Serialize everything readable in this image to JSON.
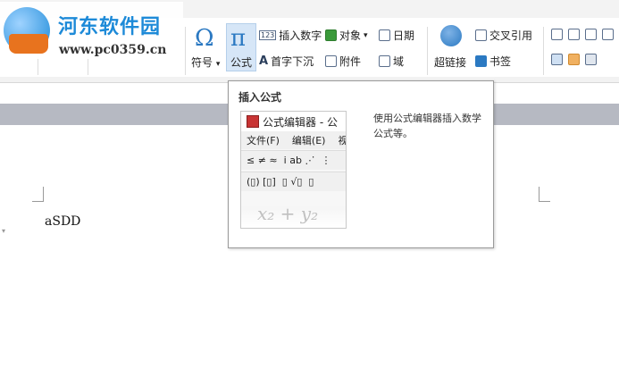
{
  "watermark": {
    "title": "河东软件园",
    "url": "www.pc0359.cn"
  },
  "ribbon": {
    "symbol_label": "符号",
    "formula_label": "公式",
    "insert_number_label": "插入数字",
    "first_letter_label": "首字下沉",
    "object_label": "对象",
    "attachment_label": "附件",
    "date_label": "日期",
    "field_label": "域",
    "hyperlink_label": "超链接",
    "cross_ref_label": "交叉引用",
    "bookmark_label": "书签",
    "dropdown_arrow": "▾",
    "number_icon_text": "123"
  },
  "tooltip": {
    "title": "插入公式",
    "description": "使用公式编辑器插入数学公式等。",
    "preview": {
      "window_title": "公式编辑器 - 公",
      "menu_file": "文件(F)",
      "menu_edit": "编辑(E)",
      "menu_more": "视",
      "row1": [
        "≤ ≠ ≈",
        "ⅰ ab ⋰",
        "⋮"
      ],
      "row2": [
        "(▯) [▯]",
        "▯ √▯",
        "▯"
      ],
      "formula": "x₂ + y₂"
    }
  },
  "document": {
    "text": "aSDD"
  },
  "colors": {
    "accent": "#2b79c2",
    "band": "#b6b9c2",
    "highlight": "#d6e6f7"
  }
}
